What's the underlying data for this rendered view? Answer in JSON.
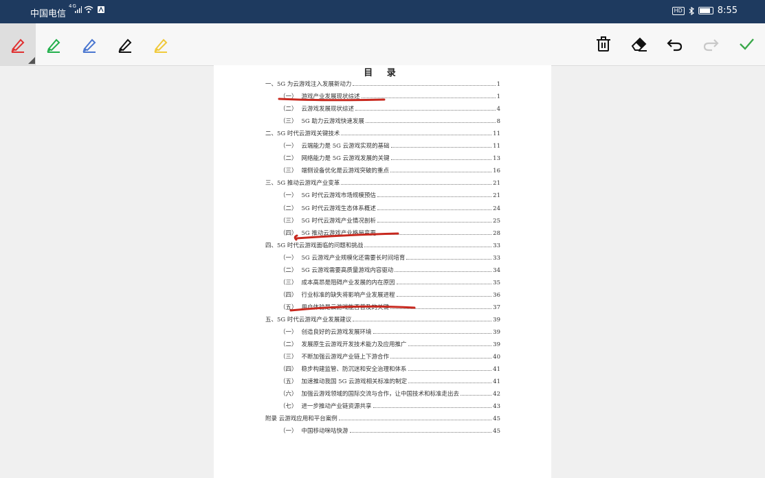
{
  "status_bar": {
    "carrier": "中国电信",
    "network": "4G",
    "time": "8:55",
    "hd_badge": "HD"
  },
  "toolbar": {
    "pens": [
      {
        "name": "red",
        "color": "#e03030"
      },
      {
        "name": "green",
        "color": "#22b04c"
      },
      {
        "name": "blue",
        "color": "#4a76d0"
      },
      {
        "name": "black",
        "color": "#111111"
      },
      {
        "name": "yellow",
        "color": "#f0c93a"
      }
    ],
    "selected_pen": "red",
    "actions": [
      "delete-icon",
      "eraser-icon",
      "undo-icon",
      "redo-icon",
      "confirm-icon"
    ]
  },
  "document": {
    "title": "目 录",
    "entries": [
      {
        "text": "一、5G 为云游戏注入发展新动力",
        "page": "1"
      },
      {
        "num": "（一）",
        "text": "游戏产业发展现状综述",
        "page": "1"
      },
      {
        "num": "（二）",
        "text": "云游戏发展现状综述",
        "page": "4"
      },
      {
        "num": "（三）",
        "text": "5G 助力云游戏快速发展",
        "page": "8"
      },
      {
        "text": "二、5G 时代云游戏关键技术",
        "page": "11"
      },
      {
        "num": "（一）",
        "text": "云端能力是 5G 云游戏实现的基础",
        "page": "11"
      },
      {
        "num": "（二）",
        "text": "网络能力是 5G 云游戏发展的关键",
        "page": "13"
      },
      {
        "num": "（三）",
        "text": "端侧设备优化是云游戏突破的重点",
        "page": "16"
      },
      {
        "text": "三、5G 推动云游戏产业变革",
        "page": "21"
      },
      {
        "num": "（一）",
        "text": "5G 时代云游戏市场规模预估",
        "page": "21"
      },
      {
        "num": "（二）",
        "text": "5G 时代云游戏生态体系概述",
        "page": "24"
      },
      {
        "num": "（三）",
        "text": "5G 时代云游戏产业情况剖析",
        "page": "25"
      },
      {
        "num": "（四）",
        "text": "5G 推动云游戏产业格局变更",
        "page": "28"
      },
      {
        "text": "四、5G 时代云游戏面临的问题和挑战",
        "page": "33"
      },
      {
        "num": "（一）",
        "text": "5G 云游戏产业规模化还需要长时间培育",
        "page": "33"
      },
      {
        "num": "（二）",
        "text": "5G 云游戏需要高质量游戏内容驱动",
        "page": "34"
      },
      {
        "num": "（三）",
        "text": "成本高昂是阻碍产业发展的内在原因",
        "page": "35"
      },
      {
        "num": "（四）",
        "text": "行业标准的缺失将影响产业发展进程",
        "page": "36"
      },
      {
        "num": "（五）",
        "text": "用户体验是云游戏能否普及的关键",
        "page": "37"
      },
      {
        "text": "五、5G 时代云游戏产业发展建议",
        "page": "39"
      },
      {
        "num": "（一）",
        "text": "创造良好的云游戏发展环境",
        "page": "39"
      },
      {
        "num": "（二）",
        "text": "发展原生云游戏开发技术能力及应用推广",
        "page": "39"
      },
      {
        "num": "（三）",
        "text": "不断加强云游戏产业链上下游合作",
        "page": "40"
      },
      {
        "num": "（四）",
        "text": "稳步构建监管、防沉迷和安全治理和体系",
        "page": "41"
      },
      {
        "num": "（五）",
        "text": "加速推动我国 5G 云游戏相关标准的制定",
        "page": "41"
      },
      {
        "num": "（六）",
        "text": "加强云游戏领域的国际交流与合作，让中国技术和标准走出去",
        "page": "42"
      },
      {
        "num": "（七）",
        "text": "进一步推动产业链资源共享",
        "page": "43"
      },
      {
        "text": "附录 云游戏应用和平台案例",
        "page": "45"
      },
      {
        "num": "（一）",
        "text": "中国移动咪咕快游",
        "page": "45"
      }
    ]
  }
}
